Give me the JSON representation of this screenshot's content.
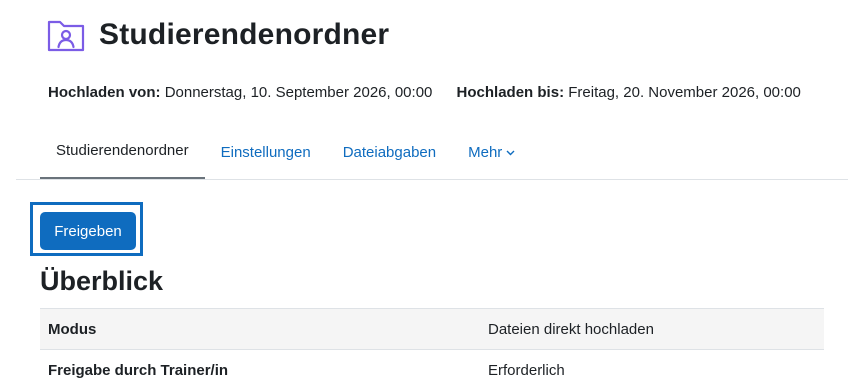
{
  "header": {
    "title": "Studierendenordner",
    "icon": "folder-user-icon",
    "icon_color": "#7b5ce6"
  },
  "dates": {
    "upload_from_label": "Hochladen von:",
    "upload_from_value": "Donnerstag, 10. September 2026, 00:00",
    "upload_until_label": "Hochladen bis:",
    "upload_until_value": "Freitag, 20. November 2026, 00:00"
  },
  "tabs": [
    {
      "label": "Studierendenordner",
      "active": true
    },
    {
      "label": "Einstellungen",
      "active": false
    },
    {
      "label": "Dateiabgaben",
      "active": false
    },
    {
      "label": "Mehr",
      "active": false,
      "dropdown": true
    }
  ],
  "actions": {
    "release_label": "Freigeben"
  },
  "overview": {
    "title": "Überblick",
    "rows": [
      {
        "key": "Modus",
        "value": "Dateien direkt hochladen"
      },
      {
        "key": "Freigabe durch Trainer/in",
        "value": "Erforderlich"
      }
    ]
  },
  "colors": {
    "accent": "#0f6cbf",
    "tab_active_underline": "#6a737b"
  }
}
